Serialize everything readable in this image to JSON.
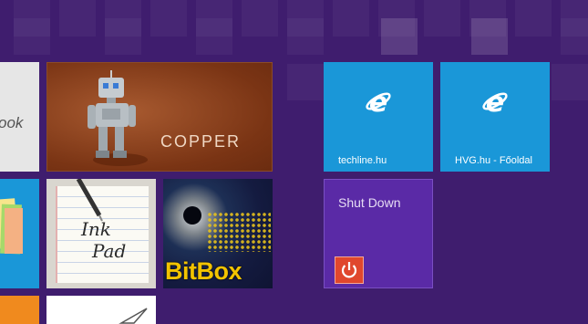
{
  "colors": {
    "background": "#3f1d6e",
    "ie_tile": "#1a97d8",
    "shutdown_tile": "#5a2aa6",
    "power_button": "#e0472d"
  },
  "tiles": {
    "left_partial": {
      "label": "ook"
    },
    "copper": {
      "label": "COPPER"
    },
    "techline": {
      "label": "techline.hu",
      "icon": "internet-explorer-icon"
    },
    "hvg": {
      "label": "HVG.hu - Főoldal",
      "icon": "internet-explorer-icon"
    },
    "shutdown": {
      "label": "Shut Down",
      "icon": "power-icon"
    },
    "inkpad": {
      "logo_text": "Ink Pad"
    },
    "bitbox": {
      "label": "BitBox"
    }
  }
}
